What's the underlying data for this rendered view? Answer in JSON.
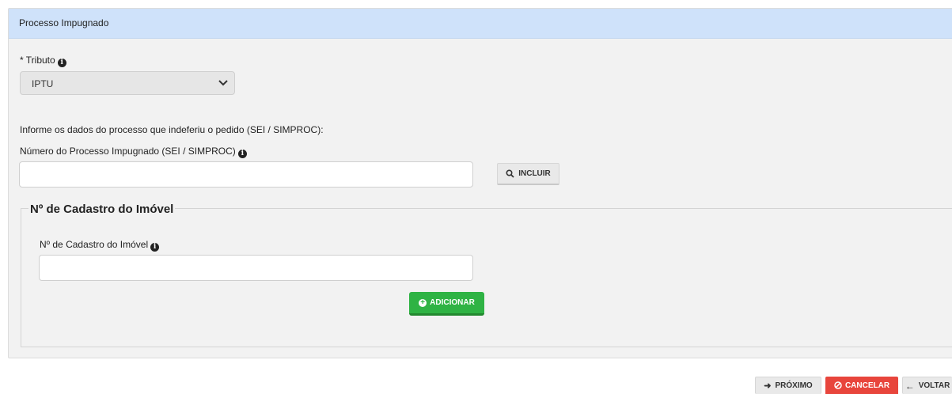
{
  "panel": {
    "title": "Processo Impugnado"
  },
  "tributo": {
    "label": "* Tributo",
    "selected": "IPTU"
  },
  "processo": {
    "instructions": "Informe os dados do processo que indeferiu o pedido (SEI / SIMPROC):",
    "label": "Número do Processo Impugnado (SEI / SIMPROC)",
    "value": "",
    "include_label": "INCLUIR"
  },
  "cadastro": {
    "legend": "Nº de Cadastro do Imóvel",
    "label": "Nº de Cadastro do Imóvel",
    "value": "",
    "add_label": "ADICIONAR"
  },
  "footer": {
    "next_label": "PRÓXIMO",
    "cancel_label": "CANCELAR",
    "back_label": "VOLTAR"
  },
  "colors": {
    "header_bg": "#cfe2fa",
    "success": "#2fb344",
    "danger": "#e8453c"
  }
}
